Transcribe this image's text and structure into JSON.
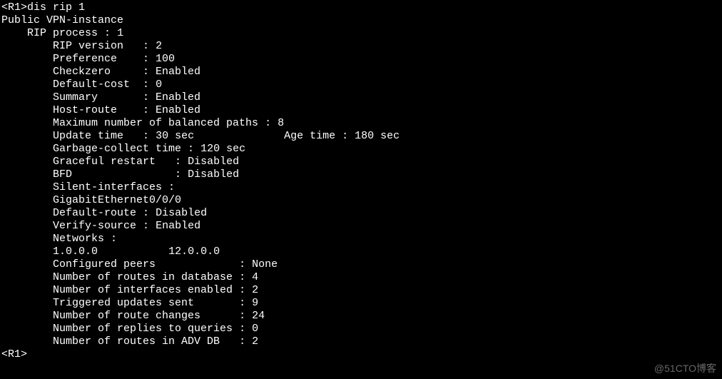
{
  "prompt1": "<R1>",
  "command": "dis rip 1",
  "header": "Public VPN-instance",
  "process_label": "RIP process",
  "process_id": "1",
  "fields": {
    "rip_version": {
      "label": "RIP version",
      "value": "2"
    },
    "preference": {
      "label": "Preference",
      "value": "100"
    },
    "checkzero": {
      "label": "Checkzero",
      "value": "Enabled"
    },
    "default_cost": {
      "label": "Default-cost",
      "value": "0"
    },
    "summary": {
      "label": "Summary",
      "value": "Enabled"
    },
    "host_route": {
      "label": "Host-route",
      "value": "Enabled"
    }
  },
  "max_balanced": {
    "label": "Maximum number of balanced paths",
    "value": "8"
  },
  "update_time": {
    "label": "Update time",
    "value": "30 sec"
  },
  "age_time": {
    "label": "Age time",
    "value": "180 sec"
  },
  "garbage": {
    "label": "Garbage-collect time",
    "value": "120 sec"
  },
  "graceful": {
    "label": "Graceful restart",
    "value": "Disabled"
  },
  "bfd": {
    "label": "BFD",
    "value": "Disabled"
  },
  "silent_label": "Silent-interfaces :",
  "silent_if": "GigabitEthernet0/0/0",
  "default_route": {
    "label": "Default-route",
    "value": "Disabled"
  },
  "verify_source": {
    "label": "Verify-source",
    "value": "Enabled"
  },
  "networks_label": "Networks :",
  "network1": "1.0.0.0",
  "network2": "12.0.0.0",
  "stats": {
    "peers": {
      "label": "Configured peers",
      "value": "None"
    },
    "routes_db": {
      "label": "Number of routes in database",
      "value": "4"
    },
    "if_en": {
      "label": "Number of interfaces enabled",
      "value": "2"
    },
    "trig": {
      "label": "Triggered updates sent",
      "value": "9"
    },
    "rchg": {
      "label": "Number of route changes",
      "value": "24"
    },
    "repl": {
      "label": "Number of replies to queries",
      "value": "0"
    },
    "advdb": {
      "label": "Number of routes in ADV DB",
      "value": "2"
    }
  },
  "prompt2": "<R1>",
  "watermark": "@51CTO博客"
}
